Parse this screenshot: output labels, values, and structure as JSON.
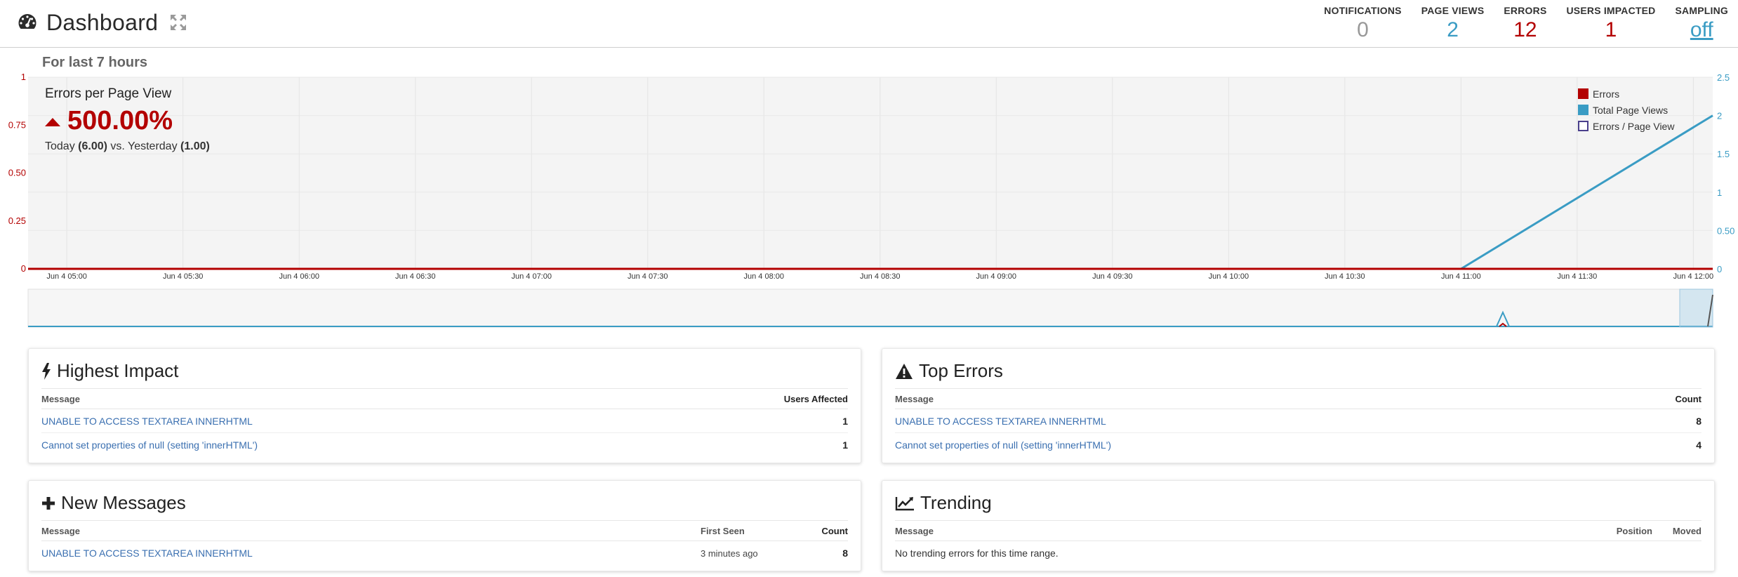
{
  "header": {
    "title": "Dashboard",
    "icons": {
      "dashboard": "gauge-icon",
      "expand": "expand-arrows-icon"
    },
    "stats": [
      {
        "label": "NOTIFICATIONS",
        "value": "0",
        "color": "#999999"
      },
      {
        "label": "PAGE VIEWS",
        "value": "2",
        "color": "#3a9cc4"
      },
      {
        "label": "ERRORS",
        "value": "12",
        "color": "#b30000"
      },
      {
        "label": "USERS IMPACTED",
        "value": "1",
        "color": "#b30000"
      },
      {
        "label": "SAMPLING",
        "value": "off",
        "color": "#3a9cc4"
      }
    ]
  },
  "subtitle": "For last 7 hours",
  "kpi": {
    "title": "Errors per Page View",
    "value": "500.00%",
    "today_label": "Today",
    "today_value": "(6.00)",
    "vs_label": "vs. Yesterday",
    "yesterday_value": "(1.00)"
  },
  "colors": {
    "errors": "#b30000",
    "page_views": "#3a9cc4",
    "ratio": "#4a3f8c"
  },
  "chart_data": {
    "type": "line",
    "x": [
      "Jun 4 05:00",
      "Jun 4 05:30",
      "Jun 4 06:00",
      "Jun 4 06:30",
      "Jun 4 07:00",
      "Jun 4 07:30",
      "Jun 4 08:00",
      "Jun 4 08:30",
      "Jun 4 09:00",
      "Jun 4 09:30",
      "Jun 4 10:00",
      "Jun 4 10:30",
      "Jun 4 11:00",
      "Jun 4 11:30",
      "Jun 4 12:00"
    ],
    "left_ticks": [
      "0",
      "0.25",
      "0.50",
      "0.75",
      "1"
    ],
    "right_ticks": [
      "0",
      "0.50",
      "1",
      "1.5",
      "2",
      "2.5"
    ],
    "ylim_left": [
      0,
      1
    ],
    "ylim_right": [
      0,
      2.5
    ],
    "legend_placement": "top-right",
    "series": [
      {
        "name": "Errors",
        "color": "#b30000",
        "points": [
          [
            "Jun 4 04:50",
            0
          ],
          [
            "Jun 4 12:05",
            0
          ]
        ]
      },
      {
        "name": "Total Page Views",
        "color": "#3a9cc4",
        "points": [
          [
            "Jun 4 04:50",
            0
          ],
          [
            "Jun 4 11:00",
            0
          ],
          [
            "Jun 4 12:05",
            2
          ]
        ]
      },
      {
        "name": "Errors / Page View",
        "color": "#4a3f8c",
        "points": []
      }
    ],
    "grid": true
  },
  "panels": {
    "highest_impact": {
      "title": "Highest Impact",
      "icon": "bolt-icon",
      "columns": [
        "Message",
        "Users Affected"
      ],
      "rows": [
        {
          "message": "UNABLE TO ACCESS TEXTAREA INNERHTML",
          "value": "1"
        },
        {
          "message": "Cannot set properties of null (setting 'innerHTML')",
          "value": "1"
        }
      ]
    },
    "top_errors": {
      "title": "Top Errors",
      "icon": "warning-icon",
      "columns": [
        "Message",
        "Count"
      ],
      "rows": [
        {
          "message": "UNABLE TO ACCESS TEXTAREA INNERHTML",
          "value": "8"
        },
        {
          "message": "Cannot set properties of null (setting 'innerHTML')",
          "value": "4"
        }
      ]
    },
    "new_messages": {
      "title": "New Messages",
      "icon": "plus-icon",
      "columns": [
        "Message",
        "First Seen",
        "Count"
      ],
      "rows": [
        {
          "message": "UNABLE TO ACCESS TEXTAREA INNERHTML",
          "first_seen": "3 minutes ago",
          "value": "8"
        }
      ]
    },
    "trending": {
      "title": "Trending",
      "icon": "line-chart-icon",
      "columns": [
        "Message",
        "Position",
        "Moved"
      ],
      "empty_text": "No trending errors for this time range."
    }
  }
}
